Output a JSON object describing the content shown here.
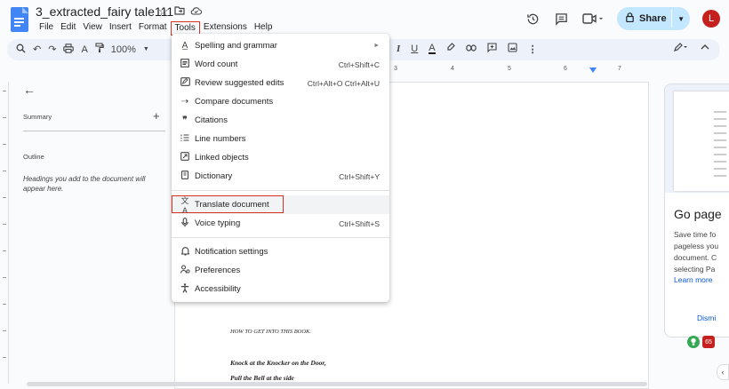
{
  "doc": {
    "title": "3_extracted_fairy tale111"
  },
  "menubar": [
    "File",
    "Edit",
    "View",
    "Insert",
    "Format",
    "Tools",
    "Extensions",
    "Help"
  ],
  "header": {
    "share_label": "Share",
    "avatar_letter": "L"
  },
  "toolbar": {
    "zoom": "100%"
  },
  "ruler": {
    "marks": [
      "3",
      "4",
      "5",
      "6",
      "7"
    ]
  },
  "outline": {
    "summary_label": "Summary",
    "outline_label": "Outline",
    "hint": "Headings you add to the document will appear here."
  },
  "page": {
    "line1": "HOW TO GET INTO THIS BOOK.",
    "line2": "Knock at the Knocker on the Door,",
    "line3": "Pull the Bell at the side"
  },
  "side_panel": {
    "title": "Go page",
    "body_lines": [
      "Save time fo",
      "pageless you",
      "document. C",
      "selecting Pa"
    ],
    "learn_more": "Learn more",
    "dismiss": "Dismi",
    "badge_count": "65"
  },
  "tools_menu": {
    "items": [
      {
        "icon": "spellcheck-icon",
        "label": "Spelling and grammar",
        "shortcut": "",
        "submenu": true
      },
      {
        "icon": "word-count-icon",
        "label": "Word count",
        "shortcut": "Ctrl+Shift+C"
      },
      {
        "icon": "review-edits-icon",
        "label": "Review suggested edits",
        "shortcut": "Ctrl+Alt+O Ctrl+Alt+U"
      },
      {
        "icon": "compare-icon",
        "label": "Compare documents",
        "shortcut": ""
      },
      {
        "icon": "quote-icon",
        "label": "Citations",
        "shortcut": ""
      },
      {
        "icon": "line-numbers-icon",
        "label": "Line numbers",
        "shortcut": ""
      },
      {
        "icon": "linked-objects-icon",
        "label": "Linked objects",
        "shortcut": ""
      },
      {
        "icon": "dictionary-icon",
        "label": "Dictionary",
        "shortcut": "Ctrl+Shift+Y"
      },
      {
        "icon": "translate-icon",
        "label": "Translate document",
        "shortcut": ""
      },
      {
        "icon": "microphone-icon",
        "label": "Voice typing",
        "shortcut": "Ctrl+Shift+S"
      },
      {
        "icon": "bell-icon",
        "label": "Notification settings",
        "shortcut": ""
      },
      {
        "icon": "preferences-icon",
        "label": "Preferences",
        "shortcut": ""
      },
      {
        "icon": "accessibility-icon",
        "label": "Accessibility",
        "shortcut": ""
      }
    ]
  },
  "colors": {
    "accent": "#0b57d0",
    "share_bg": "#c2e7ff",
    "avatar": "#c5221f",
    "highlight_border": "#d93025"
  }
}
